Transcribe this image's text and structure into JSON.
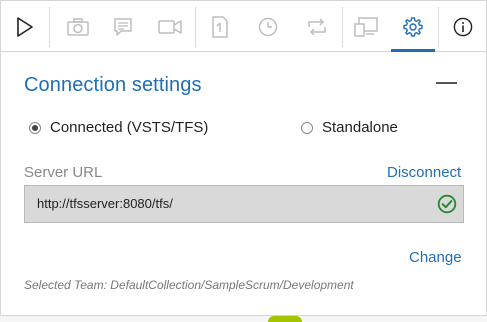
{
  "toolbar": {
    "icons": [
      "play-icon",
      "camera-icon",
      "comment-icon",
      "video-icon",
      "document-icon",
      "clock-icon",
      "loop-icon",
      "devices-icon",
      "gear-icon",
      "info-icon"
    ],
    "active": "settings",
    "accent_color": "#1e6fb8"
  },
  "panel": {
    "title": "Connection settings",
    "mode_options": [
      {
        "label": "Connected (VSTS/TFS)",
        "selected": true
      },
      {
        "label": "Standalone",
        "selected": false
      }
    ],
    "server_url_label": "Server URL",
    "disconnect_label": "Disconnect",
    "server_url_value": "http://tfsserver:8080/tfs/",
    "connection_status": "ok",
    "change_label": "Change",
    "selected_team": "Selected Team:  DefaultCollection/SampleScrum/Development"
  }
}
